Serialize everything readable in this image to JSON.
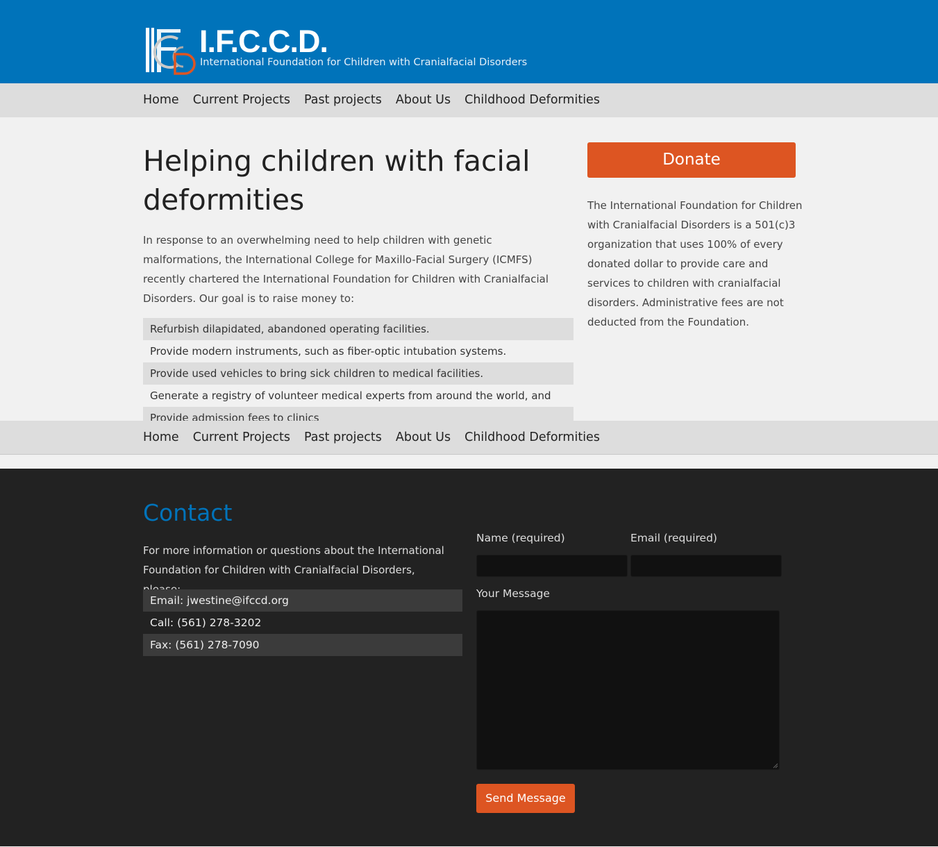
{
  "header": {
    "title": "I.F.C.C.D.",
    "tagline": "International Foundation for Children with Cranialfacial Disorders",
    "logo_letters": "IFCCD"
  },
  "nav": {
    "items": [
      "Home",
      "Current Projects",
      "Past projects",
      "About Us",
      "Childhood Deformities"
    ]
  },
  "main": {
    "headline": "Helping children with facial deformities",
    "intro": "In response to an overwhelming need to help children with genetic malformations, the International College for Maxillo-Facial Surgery (ICMFS) recently chartered the International Foundation for Children with Cranialfacial Disorders. Our goal is to raise money to:",
    "goals": [
      "Refurbish dilapidated, abandoned operating facilities.",
      "Provide modern instruments, such as fiber-optic intubation systems.",
      "Provide used vehicles to bring sick children to medical facilities.",
      "Generate a registry of volunteer medical experts from around the world, and",
      "Provide admission fees to clinics"
    ]
  },
  "sidebar": {
    "donate_label": "Donate",
    "about": "The International Foundation for Children with Cranialfacial Disorders is a 501(c)3 organization that uses 100% of every donated dollar to provide care and services to children with cranialfacial disorders. Administrative fees are not deducted from the Foundation."
  },
  "footer": {
    "contact_title": "Contact",
    "contact_text": "For more information or questions about the International Foundation for Children with Cranialfacial Disorders, please:",
    "contact_items": [
      "Email: jwestine@ifccd.org",
      "Call: (561) 278-3202",
      "Fax: (561) 278-7090"
    ],
    "form": {
      "name_label": "Name (required)",
      "email_label": "Email (required)",
      "message_label": "Your Message",
      "submit_label": "Send Message"
    }
  },
  "colors": {
    "header_blue": "#0073ba",
    "accent_orange": "#dd5522",
    "nav_gray": "#dddddd",
    "footer_dark": "#222222"
  }
}
